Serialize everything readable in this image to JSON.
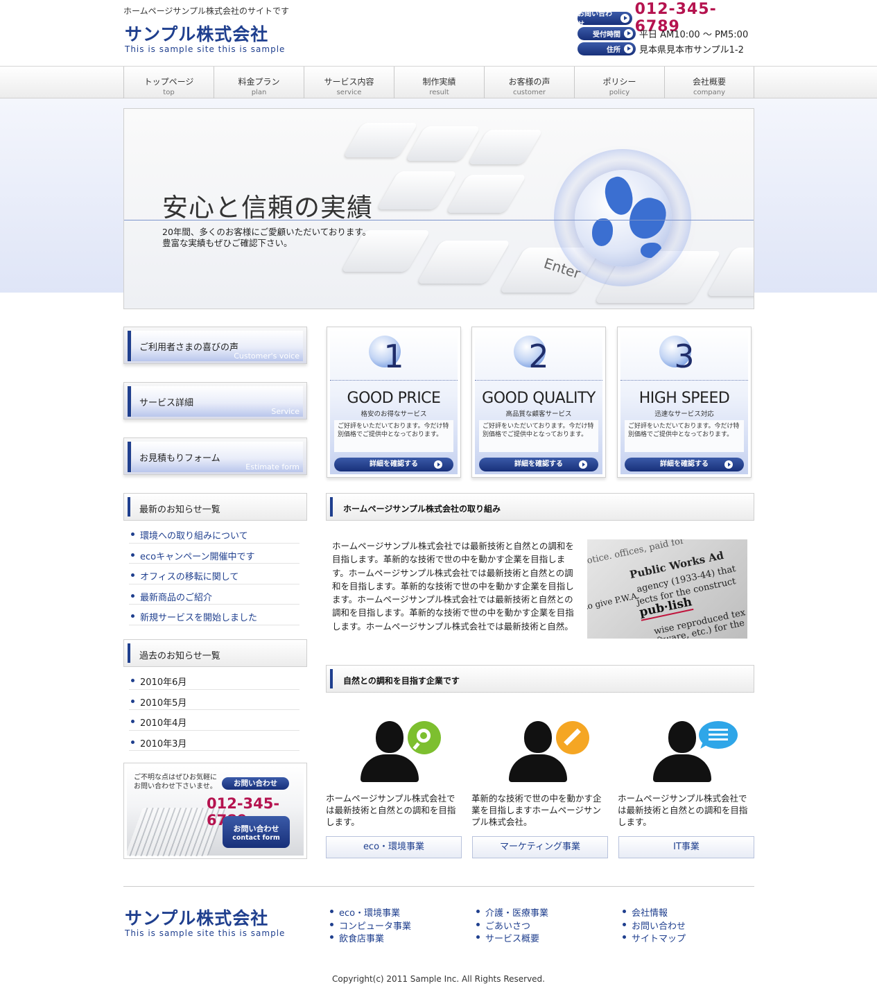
{
  "header": {
    "tagline": "ホームページサンプル株式会社のサイトです",
    "logo_jp": "サンプル株式会社",
    "logo_en": "This is sample site this is sample",
    "contact_label": "お問い合わせ",
    "phone": "012-345-6789",
    "hours_label": "受付時間",
    "hours": "平日 AM10:00 ～ PM5:00",
    "address_label": "住所",
    "address": "見本県見本市サンプル1-2"
  },
  "nav": [
    {
      "jp": "トップページ",
      "en": "top"
    },
    {
      "jp": "料金プラン",
      "en": "plan"
    },
    {
      "jp": "サービス内容",
      "en": "service"
    },
    {
      "jp": "制作実績",
      "en": "result"
    },
    {
      "jp": "お客様の声",
      "en": "customer"
    },
    {
      "jp": "ポリシー",
      "en": "policy"
    },
    {
      "jp": "会社概要",
      "en": "company"
    }
  ],
  "hero": {
    "title": "安心と信頼の実績",
    "line1": "20年間、多くのお客様にご愛顧いただいております。",
    "line2": "豊富な実績もぜひご確認下さい。",
    "key_label": "Enter"
  },
  "sidebar": {
    "banners": [
      {
        "jp": "ご利用者さまの喜びの声",
        "en": "Customer's voice"
      },
      {
        "jp": "サービス詳細",
        "en": "Service"
      },
      {
        "jp": "お見積もりフォーム",
        "en": "Estimate form"
      }
    ],
    "news_title": "最新のお知らせ一覧",
    "news": [
      "環境への取り組みについて",
      "ecoキャンペーン開催中です",
      "オフィスの移転に関して",
      "最新商品のご紹介",
      "新規サービスを開始しました"
    ],
    "archive_title": "過去のお知らせ一覧",
    "archive": [
      "2010年6月",
      "2010年5月",
      "2010年4月",
      "2010年3月"
    ],
    "contact": {
      "text1": "ご不明な点はぜひお気軽に",
      "text2": "お問い合わせ下さいませ。",
      "pill": "お問い合わせ",
      "phone": "012-345-6789",
      "btn_jp": "お問い合わせ",
      "btn_en": "contact form"
    }
  },
  "features": [
    {
      "num": "1",
      "title": "GOOD PRICE",
      "sub": "格安のお得なサービス",
      "desc": "ご好評をいただいております。今だけ特別価格でご提供中となっております。",
      "button": "詳細を確認する"
    },
    {
      "num": "2",
      "title": "GOOD QUALITY",
      "sub": "高品質な顧客サービス",
      "desc": "ご好評をいただいております。今だけ特別価格でご提供中となっております。",
      "button": "詳細を確認する"
    },
    {
      "num": "3",
      "title": "HIGH SPEED",
      "sub": "迅速なサービス対応",
      "desc": "ご好評をいただいております。今だけ特別価格でご提供中となっております。",
      "button": "詳細を確認する"
    }
  ],
  "section1": {
    "title": "ホームページサンプル株式会社の取り組み",
    "body": "ホームページサンプル株式会社では最新技術と自然との調和を目指します。革新的な技術で世の中を動かす企業を目指します。ホームページサンプル株式会社では最新技術と自然との調和を目指します。革新的な技術で世の中を動かす企業を目指します。ホームページサンプル株式会社では最新技術と自然との調和を目指します。革新的な技術で世の中を動かす企業を目指します。ホームページサンプル株式会社では最新技術と自然。"
  },
  "section2": {
    "title": "自然との調和を目指す企業です",
    "items": [
      {
        "text": "ホームページサンプル株式会社では最新技術と自然との調和を目指します。",
        "button": "eco・環境事業",
        "badge_color": "#7dbf2f"
      },
      {
        "text": "革新的な技術で世の中を動かす企業を目指しますホームページサンプル株式会社。",
        "button": "マーケティング事業",
        "badge_color": "#f5a623"
      },
      {
        "text": "ホームページサンプル株式会社では最新技術と自然との調和を目指します。",
        "button": "IT事業",
        "badge_color": "#2fa6e8"
      }
    ]
  },
  "footer": {
    "logo_jp": "サンプル株式会社",
    "logo_en": "This is sample site this is sample",
    "col1": [
      "eco・環境事業",
      "コンピュータ事業",
      "飲食店事業"
    ],
    "col2": [
      "介護・医療事業",
      "ごあいさつ",
      "サービス概要"
    ],
    "col3": [
      "会社情報",
      "お問い合わせ",
      "サイトマップ"
    ],
    "copyright": "Copyright(c) 2011 Sample Inc. All Rights Reserved."
  },
  "colors": {
    "brand": "#1f3f8e",
    "accent": "#b5134f"
  }
}
